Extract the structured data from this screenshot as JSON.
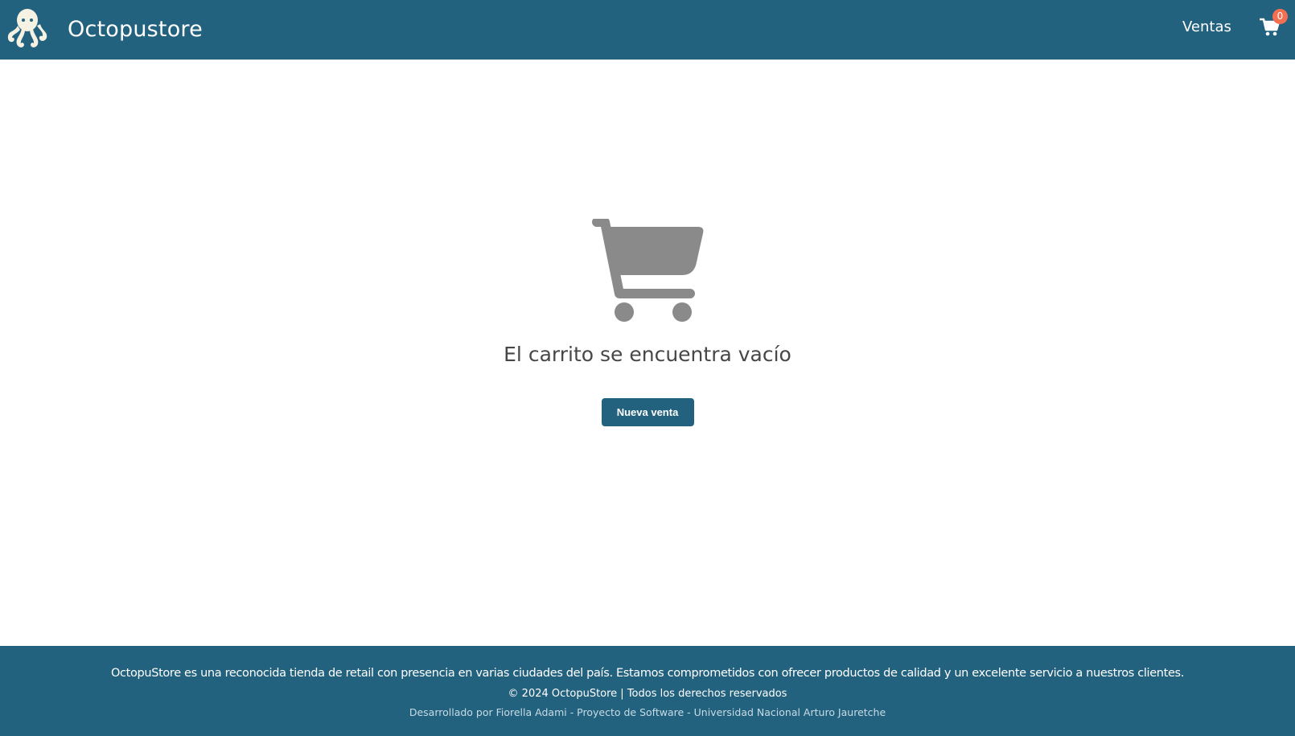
{
  "header": {
    "brand_name": "Octopustore",
    "logo_icon": "octopus-icon",
    "nav_link": "Ventas",
    "cart_icon": "cart-icon",
    "cart_count": "0",
    "background_color": "#23627e",
    "badge_color": "#f36f51"
  },
  "main": {
    "empty_icon": "cart-icon",
    "empty_message": "El carrito se encuentra vacío",
    "new_sale_label": "Nueva venta"
  },
  "footer": {
    "description": "OctopuStore es una reconocida tienda de retail con presencia en varias ciudades del país. Estamos comprometidos con ofrecer productos de calidad y un excelente servicio a nuestros clientes.",
    "copyright": "© 2024 OctopuStore | Todos los derechos reservados",
    "developer": "Desarrollado por Fiorella Adami - Proyecto de Software - Universidad Nacional Arturo Jauretche"
  }
}
